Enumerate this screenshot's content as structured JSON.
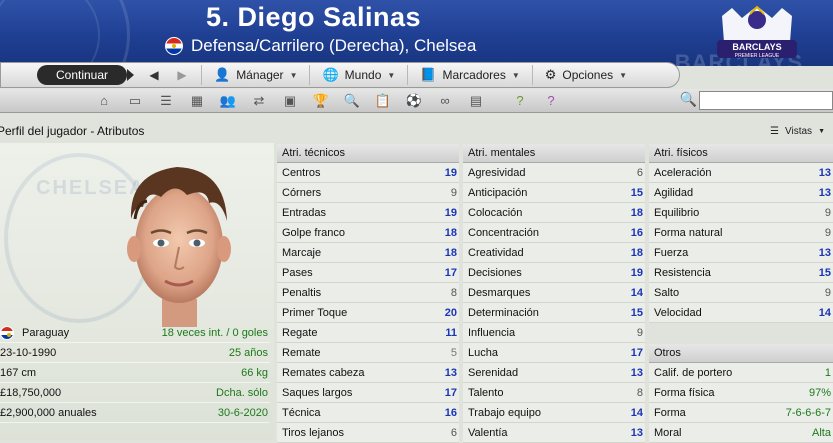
{
  "header": {
    "player_name": "5. Diego Salinas",
    "subtitle": "Defensa/Carrilero (Derecha), Chelsea",
    "league_logo_text": "BARCLAYS",
    "league_logo_subtext": "PREMIER LEAGUE",
    "watermark": "BARCLAYS"
  },
  "menubar": {
    "continue_label": "Continuar",
    "items": [
      {
        "label": "Mánager",
        "icon": "manager-icon"
      },
      {
        "label": "Mundo",
        "icon": "globe-icon"
      },
      {
        "label": "Marcadores",
        "icon": "bookmarks-icon"
      },
      {
        "label": "Opciones",
        "icon": "options-icon"
      }
    ]
  },
  "toolbar": {
    "icons": [
      "home-icon",
      "squad-icon",
      "news-icon",
      "calendar-icon",
      "staff-icon",
      "transfers-icon",
      "tactics-icon",
      "trophy-icon",
      "scout-icon",
      "clipboard-icon",
      "ball-icon",
      "binoculars-icon",
      "finance-icon",
      "help-icon",
      "question-icon"
    ]
  },
  "subheader": {
    "title": "Perfil del jugador - Atributos",
    "views_label": "Vistas"
  },
  "player": {
    "badge_text": "CHELSEA",
    "nationality": "Paraguay",
    "caps": "18 veces int. / 0 goles",
    "birthdate": "23-10-1990",
    "age": "25 años",
    "height": "167 cm",
    "weight": "66 kg",
    "value": "£18,750,000",
    "foot": "Dcha. sólo",
    "wage": "£2,900,000 anuales",
    "contract_end": "30-6-2020"
  },
  "technical": {
    "header": "Atri. técnicos",
    "rows": [
      {
        "name": "Centros",
        "value": "19"
      },
      {
        "name": "Córners",
        "value": "9"
      },
      {
        "name": "Entradas",
        "value": "19"
      },
      {
        "name": "Golpe franco",
        "value": "18"
      },
      {
        "name": "Marcaje",
        "value": "18"
      },
      {
        "name": "Pases",
        "value": "17"
      },
      {
        "name": "Penaltis",
        "value": "8"
      },
      {
        "name": "Primer Toque",
        "value": "20"
      },
      {
        "name": "Regate",
        "value": "11"
      },
      {
        "name": "Remate",
        "value": "5"
      },
      {
        "name": "Remates cabeza",
        "value": "13"
      },
      {
        "name": "Saques largos",
        "value": "17"
      },
      {
        "name": "Técnica",
        "value": "16"
      },
      {
        "name": "Tiros lejanos",
        "value": "6"
      }
    ]
  },
  "mental": {
    "header": "Atri. mentales",
    "rows": [
      {
        "name": "Agresividad",
        "value": "6"
      },
      {
        "name": "Anticipación",
        "value": "15"
      },
      {
        "name": "Colocación",
        "value": "18"
      },
      {
        "name": "Concentración",
        "value": "16"
      },
      {
        "name": "Creatividad",
        "value": "18"
      },
      {
        "name": "Decisiones",
        "value": "19"
      },
      {
        "name": "Desmarques",
        "value": "14"
      },
      {
        "name": "Determinación",
        "value": "15"
      },
      {
        "name": "Influencia",
        "value": "9"
      },
      {
        "name": "Lucha",
        "value": "17"
      },
      {
        "name": "Serenidad",
        "value": "13"
      },
      {
        "name": "Talento",
        "value": "8"
      },
      {
        "name": "Trabajo equipo",
        "value": "14"
      },
      {
        "name": "Valentía",
        "value": "13"
      }
    ]
  },
  "physical": {
    "header": "Atri. físicos",
    "rows": [
      {
        "name": "Aceleración",
        "value": "13"
      },
      {
        "name": "Agilidad",
        "value": "13"
      },
      {
        "name": "Equilibrio",
        "value": "9"
      },
      {
        "name": "Forma natural",
        "value": "9"
      },
      {
        "name": "Fuerza",
        "value": "13"
      },
      {
        "name": "Resistencia",
        "value": "15"
      },
      {
        "name": "Salto",
        "value": "9"
      },
      {
        "name": "Velocidad",
        "value": "14"
      }
    ]
  },
  "other": {
    "header": "Otros",
    "rows": [
      {
        "name": "Calif. de portero",
        "value": "1"
      },
      {
        "name": "Forma física",
        "value": "97%"
      },
      {
        "name": "Forma",
        "value": "7-6-6-6-7"
      },
      {
        "name": "Moral",
        "value": "Alta"
      }
    ]
  }
}
